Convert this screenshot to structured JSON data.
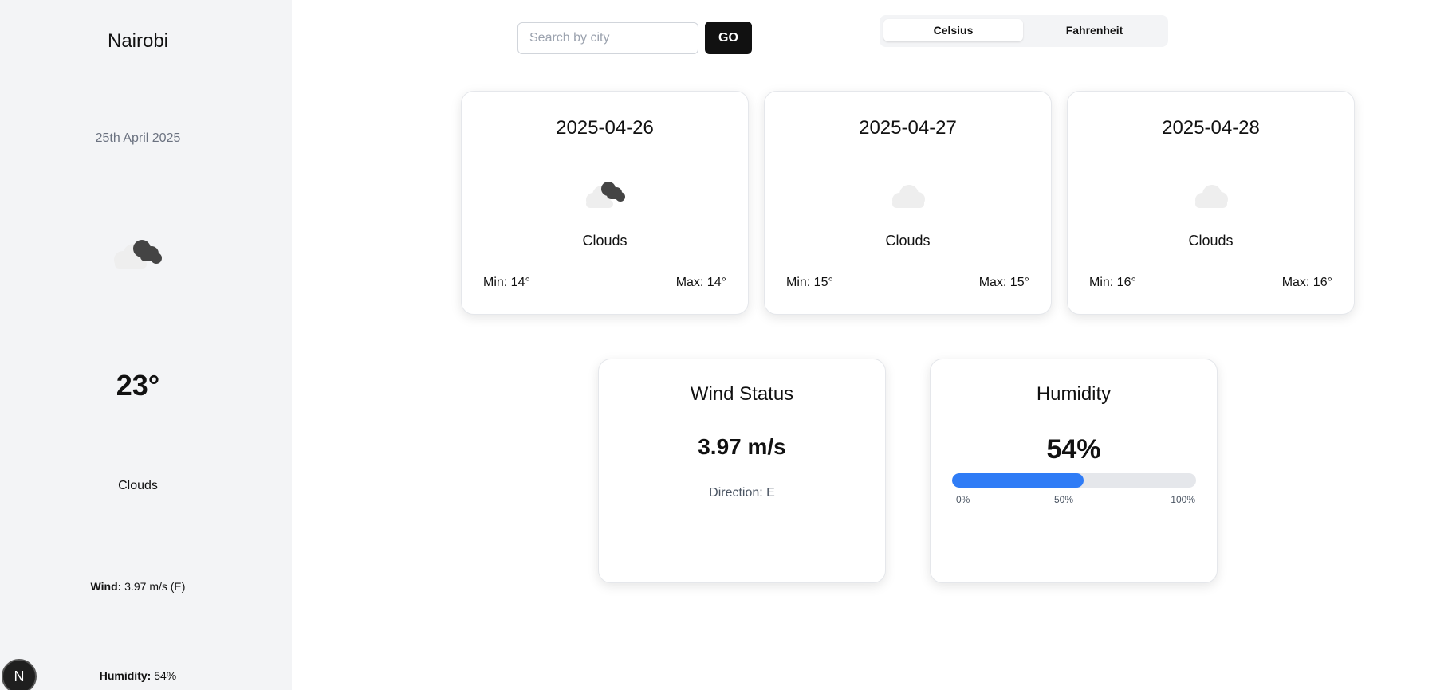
{
  "sidebar": {
    "city": "Nairobi",
    "date": "25th April 2025",
    "icon": "scattered-clouds-icon",
    "temperature": "23°",
    "condition": "Clouds",
    "wind_label": "Wind:",
    "wind_value": " 3.97 m/s (E)",
    "humidity_label": "Humidity:",
    "humidity_value": " 54%"
  },
  "badge": {
    "letter": "N"
  },
  "search": {
    "placeholder": "Search by city",
    "value": "",
    "button_label": "GO"
  },
  "units": {
    "options": [
      "Celsius",
      "Fahrenheit"
    ],
    "selected": "Celsius"
  },
  "forecast": [
    {
      "date": "2025-04-26",
      "icon": "scattered-clouds-icon",
      "condition": "Clouds",
      "min": "Min: 14°",
      "max": "Max: 14°"
    },
    {
      "date": "2025-04-27",
      "icon": "cloud-icon",
      "condition": "Clouds",
      "min": "Min: 15°",
      "max": "Max: 15°"
    },
    {
      "date": "2025-04-28",
      "icon": "cloud-icon",
      "condition": "Clouds",
      "min": "Min: 16°",
      "max": "Max: 16°"
    }
  ],
  "wind": {
    "title": "Wind Status",
    "speed": "3.97 m/s",
    "direction": "Direction: E"
  },
  "humidity": {
    "title": "Humidity",
    "value": "54%",
    "percent": 54,
    "ticks": [
      "0%",
      "50%",
      "100%"
    ]
  },
  "colors": {
    "sidebar_bg": "#f3f4f6",
    "progress_fill": "#2f7cf6",
    "button_bg": "#111111"
  }
}
